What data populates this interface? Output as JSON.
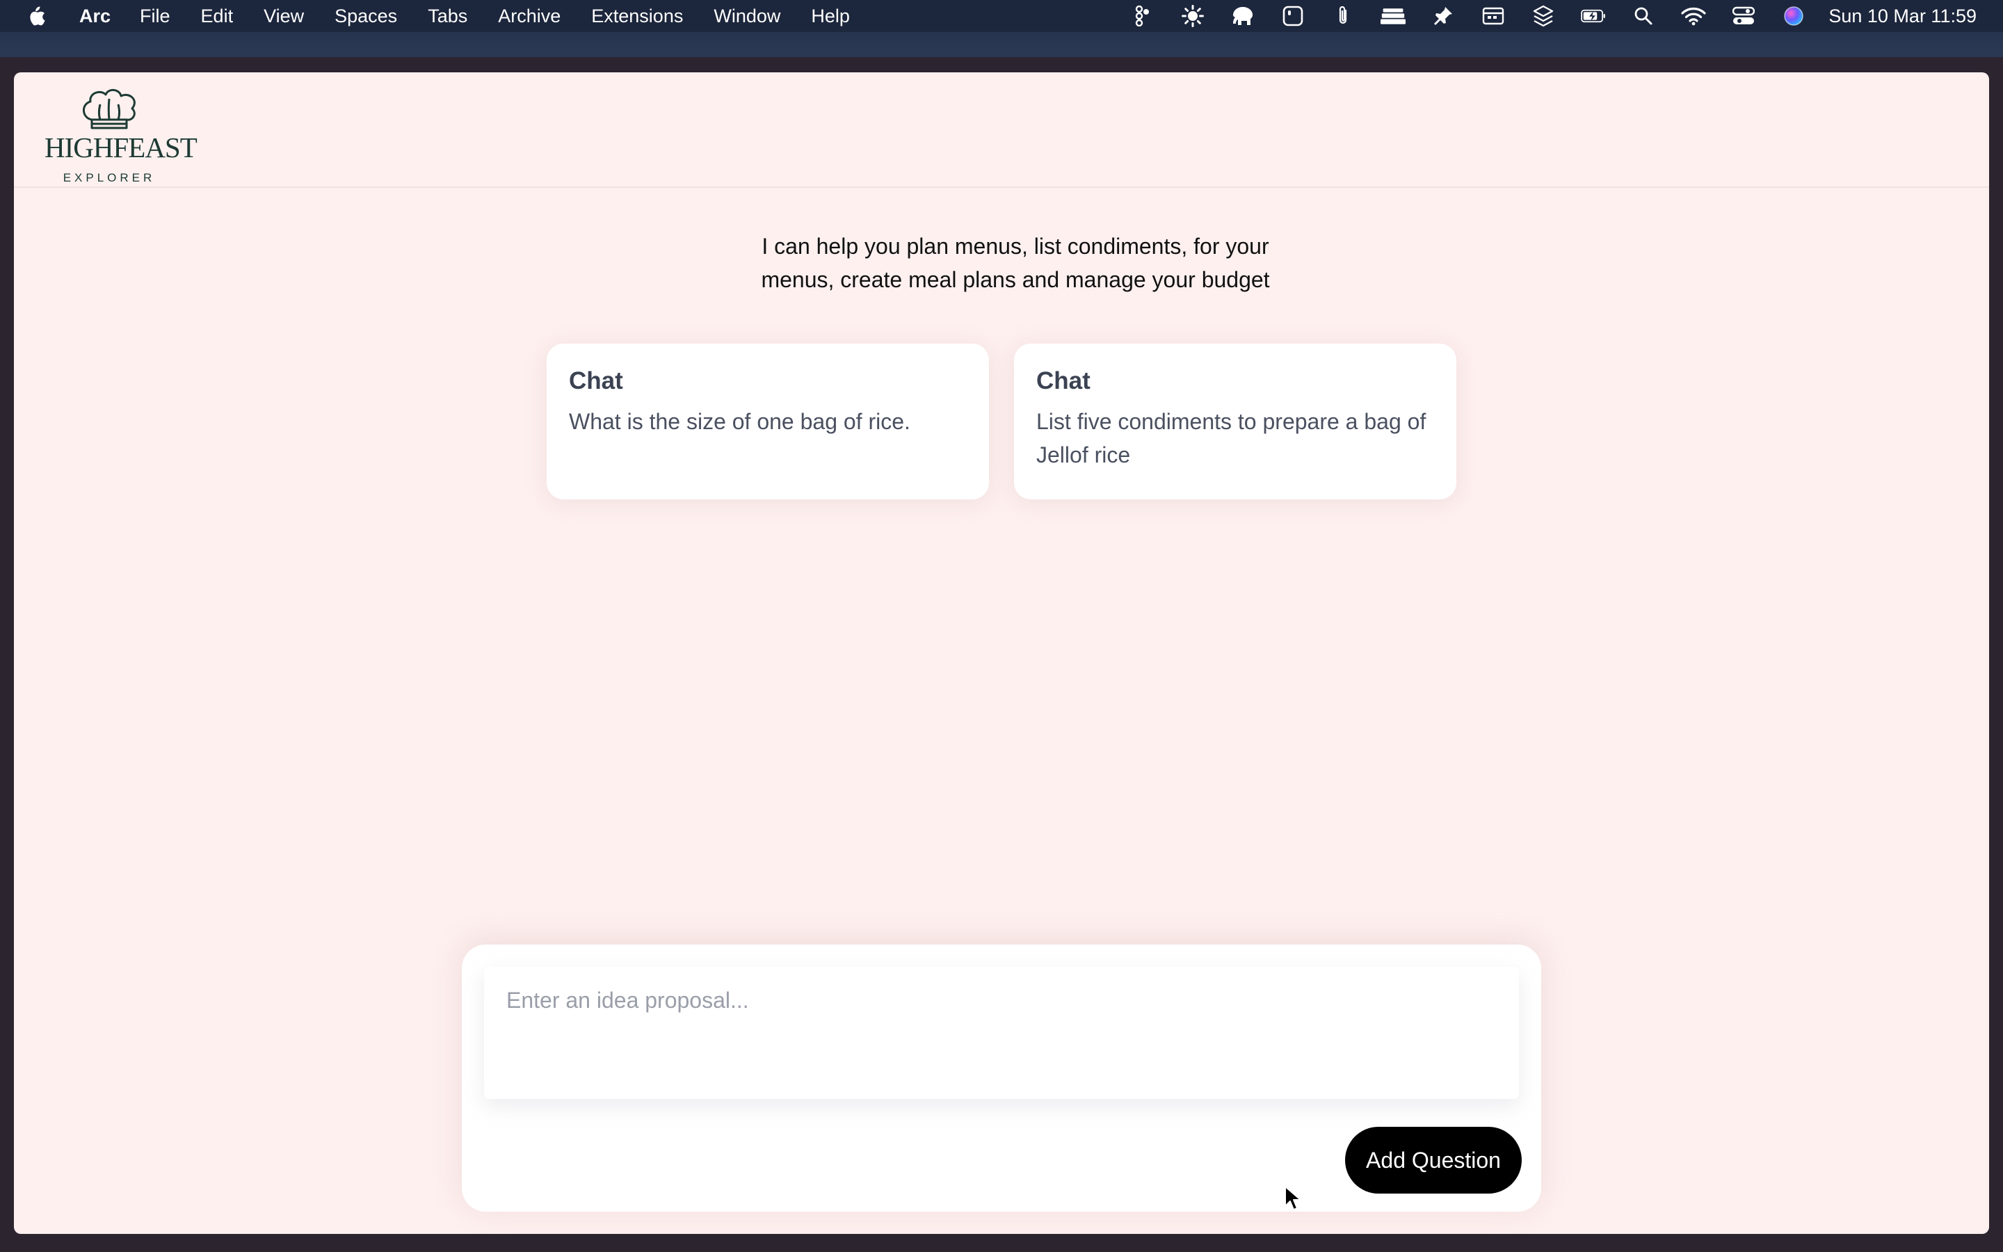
{
  "menubar": {
    "apple_icon": "apple-logo-icon",
    "app_name": "Arc",
    "items": [
      "File",
      "Edit",
      "View",
      "Spaces",
      "Tabs",
      "Archive",
      "Extensions",
      "Window",
      "Help"
    ],
    "tray_icons": [
      "figma-icon",
      "brightness-icon",
      "elephant-icon",
      "app-square-icon",
      "paperclip-icon",
      "stack-icon",
      "pin-icon",
      "calendar-icon",
      "layers-icon",
      "battery-icon",
      "search-icon",
      "wifi-icon",
      "control-center-icon",
      "siri-icon"
    ],
    "clock": "Sun 10 Mar  11:59"
  },
  "app": {
    "logo": {
      "title": "HIGHFEAST",
      "subtitle": "EXPLORER",
      "icon": "chef-hat-icon"
    },
    "intro_text": "I can help you plan menus, list condiments, for your menus, create meal plans and manage your budget",
    "cards": [
      {
        "title": "Chat",
        "text": "What is the size of one bag of rice."
      },
      {
        "title": "Chat",
        "text": "List five condiments to prepare a bag of Jellof rice"
      }
    ],
    "composer": {
      "placeholder": "Enter an idea proposal...",
      "value": "",
      "button_label": "Add Question"
    }
  },
  "colors": {
    "page_background": "#fdf0ef",
    "button_background": "#000000",
    "logo_green": "#1d3a33",
    "card_title": "#3b4252"
  }
}
